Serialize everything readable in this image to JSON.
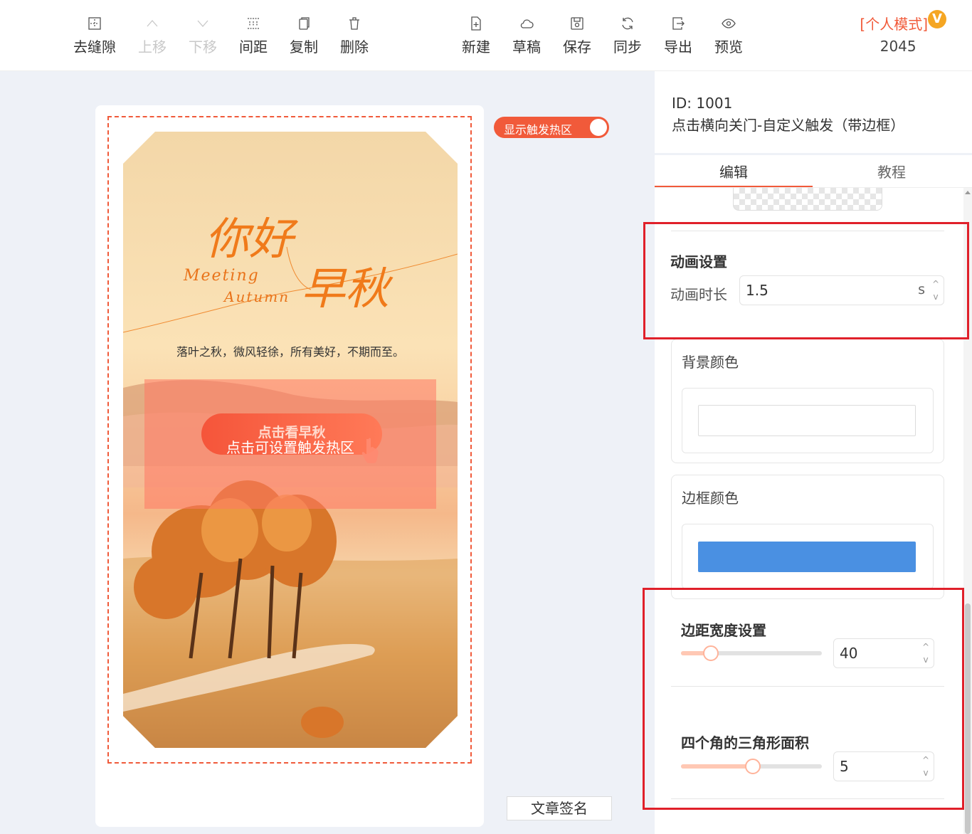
{
  "toolbar": {
    "items": [
      {
        "label": "去缝隙",
        "icon": "remove-gap-icon",
        "disabled": false
      },
      {
        "label": "上移",
        "icon": "chevron-up-icon",
        "disabled": true
      },
      {
        "label": "下移",
        "icon": "chevron-down-icon",
        "disabled": true
      },
      {
        "label": "间距",
        "icon": "spacing-icon",
        "disabled": false
      },
      {
        "label": "复制",
        "icon": "copy-icon",
        "disabled": false
      },
      {
        "label": "删除",
        "icon": "trash-icon",
        "disabled": false
      },
      {
        "label": "新建",
        "icon": "new-file-icon",
        "disabled": false
      },
      {
        "label": "草稿",
        "icon": "cloud-icon",
        "disabled": false
      },
      {
        "label": "保存",
        "icon": "save-icon",
        "disabled": false
      },
      {
        "label": "同步",
        "icon": "sync-icon",
        "disabled": false
      },
      {
        "label": "导出",
        "icon": "export-icon",
        "disabled": false
      },
      {
        "label": "预览",
        "icon": "eye-icon",
        "disabled": false
      }
    ],
    "mode_label": "[个人模式]",
    "vip_badge": "V",
    "count": "2045"
  },
  "canvas": {
    "toggle_label": "显示触发热区",
    "toggle_on": true,
    "poster": {
      "title_hello": "你好",
      "title_autumn": "早秋",
      "subtitle_line1": "Meeting",
      "subtitle_line2": "Autumn",
      "poem": "落叶之秋，微风轻徐，所有美好，不期而至。",
      "cta_label": "点击看早秋",
      "hotzone_label": "点击可设置触发热区"
    },
    "signature_label": "文章签名"
  },
  "panel": {
    "id_line": "ID: 1001",
    "component_name": "点击横向关门-自定义触发（带边框）",
    "tabs": [
      {
        "label": "编辑",
        "active": true
      },
      {
        "label": "教程",
        "active": false
      }
    ],
    "animation": {
      "title": "动画设置",
      "duration_label": "动画时长",
      "duration_value": "1.5",
      "duration_unit": "s"
    },
    "background_color": {
      "label": "背景颜色",
      "value": "#ffffff"
    },
    "border_color": {
      "label": "边框颜色",
      "value": "#4a90e2"
    },
    "margin_width": {
      "title": "边距宽度设置",
      "value": "40",
      "fraction": 0.21
    },
    "corner_area": {
      "title": "四个角的三角形面积",
      "value": "5",
      "fraction": 0.51
    },
    "spin_up": "^",
    "spin_down": "v"
  },
  "colors": {
    "accent": "#f15a3a",
    "highlight_box": "#e0202a",
    "border_color_swatch": "#4a90e2",
    "workarea_bg": "#eef1f7"
  }
}
